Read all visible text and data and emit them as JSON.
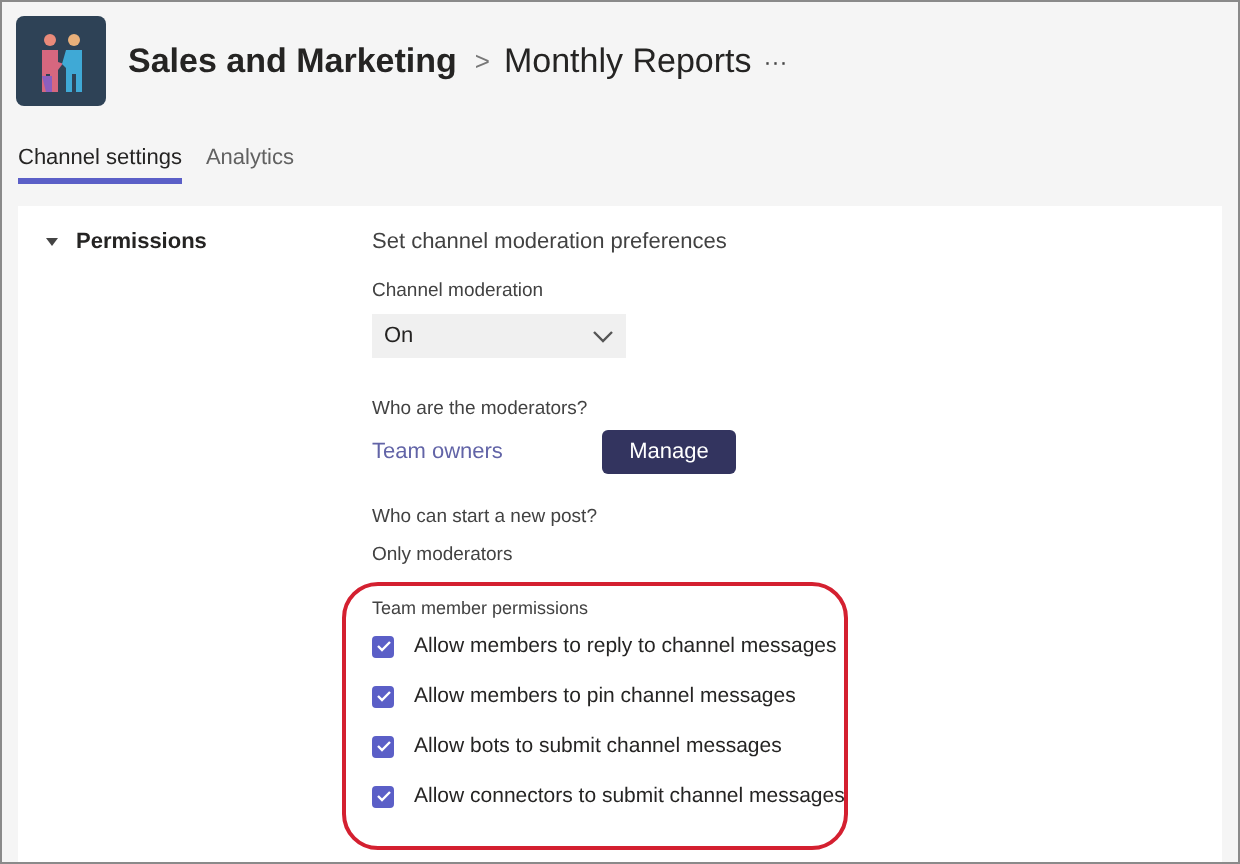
{
  "header": {
    "team": "Sales and Marketing",
    "separator": ">",
    "channel": "Monthly Reports",
    "more": "···"
  },
  "tabs": [
    {
      "label": "Channel settings",
      "selected": true
    },
    {
      "label": "Analytics",
      "selected": false
    }
  ],
  "section": {
    "title": "Permissions",
    "expanded": true,
    "heading": "Set channel moderation preferences",
    "moderation": {
      "label": "Channel moderation",
      "value": "On"
    },
    "moderators": {
      "label": "Who are the moderators?",
      "value": "Team owners",
      "button": "Manage"
    },
    "posting": {
      "label": "Who can start a new post?",
      "value": "Only moderators"
    },
    "member_permissions": {
      "label": "Team member permissions",
      "items": [
        {
          "label": "Allow members to reply to channel messages",
          "checked": true
        },
        {
          "label": "Allow members to pin channel messages",
          "checked": true
        },
        {
          "label": "Allow bots to submit channel messages",
          "checked": true
        },
        {
          "label": "Allow connectors to submit channel messages",
          "checked": true
        }
      ]
    }
  }
}
